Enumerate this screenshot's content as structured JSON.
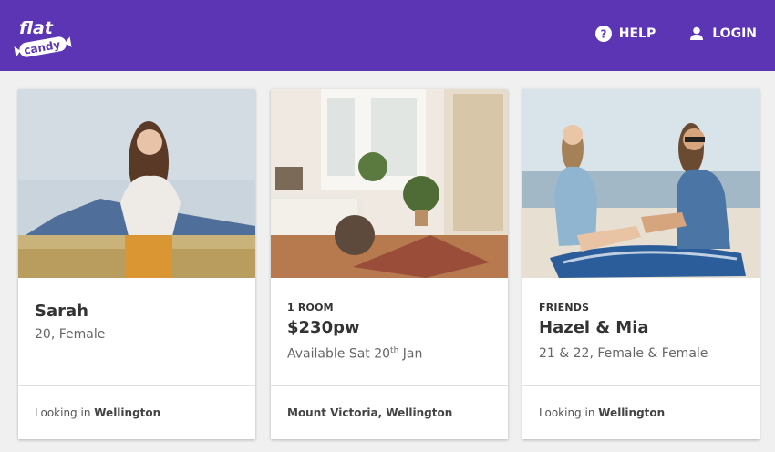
{
  "header": {
    "logo_line1": "flat",
    "logo_line2": "candy",
    "help_label": "HELP",
    "login_label": "LOGIN",
    "brand_color": "#5c35b5"
  },
  "cards": [
    {
      "image_icon": "portrait-photo",
      "name": "Sarah",
      "detail": "20, Female",
      "footer_prefix": "Looking in",
      "footer_location": "Wellington"
    },
    {
      "image_icon": "room-photo",
      "eyebrow": "1 ROOM",
      "name": "$230pw",
      "detail_prefix": "Available Sat 20",
      "detail_sup": "th",
      "detail_suffix": "Jan",
      "footer_location": "Mount Victoria, Wellington"
    },
    {
      "image_icon": "beach-friends-photo",
      "eyebrow": "FRIENDS",
      "name": "Hazel & Mia",
      "detail": "21 & 22, Female & Female",
      "footer_prefix": "Looking in",
      "footer_location": "Wellington"
    }
  ]
}
